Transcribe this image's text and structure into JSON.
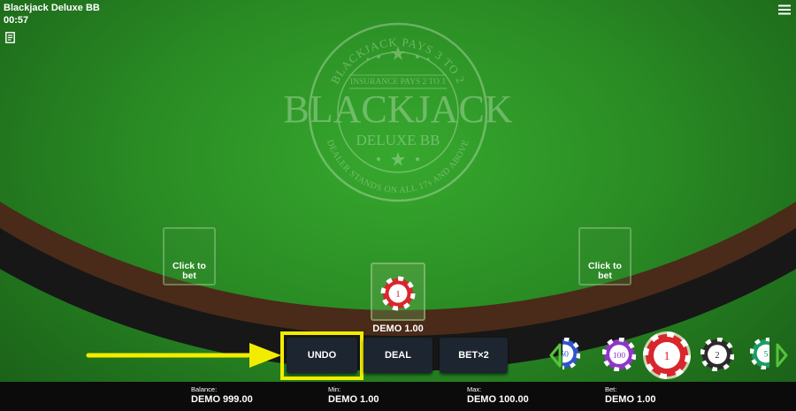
{
  "window": {
    "title": "Blackjack Deluxe BB",
    "clock": "00:57"
  },
  "icons": {
    "history": "history-icon",
    "menu": "hamburger-menu-icon"
  },
  "emblem": {
    "arc_top": "BLACKJACK PAYS 3 TO 2",
    "insurance": "INSURANCE PAYS 2 TO 1",
    "title": "BLACKJACK",
    "subtitle": "DELUXE BB",
    "arc_bottom": "DEALER STANDS ON ALL 17s AND ABOVE"
  },
  "seats": {
    "left": {
      "label": "Click to\nbet"
    },
    "center": {
      "chip_value": "1",
      "bet_label": "DEMO 1.00"
    },
    "right": {
      "label": "Click to\nbet"
    }
  },
  "actions": {
    "undo": "UNDO",
    "deal": "DEAL",
    "double": "BET×2"
  },
  "chips": [
    {
      "value": "50",
      "color": "#2f55c9"
    },
    {
      "value": "100",
      "color": "#8e37c4"
    },
    {
      "value": "1",
      "color": "#d8262c",
      "selected": true
    },
    {
      "value": "2",
      "color": "#2a2a2a"
    },
    {
      "value": "5",
      "color": "#1d9b62"
    }
  ],
  "colors": {
    "highlight": "#f2ec00",
    "felt": "#2a8c24",
    "selector_arrow": "#58c23d"
  },
  "footer": {
    "balance_label": "Balance:",
    "balance_value": "DEMO 999.00",
    "min_label": "Min:",
    "min_value": "DEMO 1.00",
    "max_label": "Max:",
    "max_value": "DEMO 100.00",
    "bet_label": "Bet:",
    "bet_value": "DEMO 1.00"
  }
}
